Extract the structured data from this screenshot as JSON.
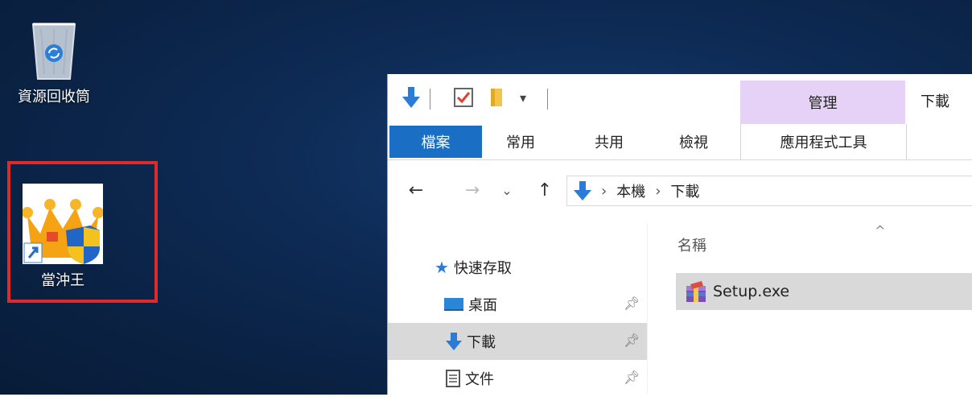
{
  "desktop": {
    "recycle_bin_label": "資源回收筒",
    "game_shortcut_label": "當沖王"
  },
  "explorer": {
    "ribbon": {
      "contextual_group": "管理",
      "window_title": "下載",
      "tabs": {
        "file": "檔案",
        "home": "常用",
        "share": "共用",
        "view": "檢視",
        "app_tools": "應用程式工具"
      }
    },
    "address": {
      "segments": [
        "本機",
        "下載"
      ]
    },
    "nav": {
      "quick_access": "快速存取",
      "desktop": "桌面",
      "downloads": "下載",
      "documents": "文件"
    },
    "files": {
      "column_name": "名稱",
      "items": [
        {
          "name": "Setup.exe"
        }
      ]
    }
  },
  "colors": {
    "desktop_bg": "#0e2c57",
    "file_tab": "#1a6fc4",
    "manage_tab": "#e6d2f6",
    "highlight_box": "#e0292a",
    "selection": "#d9d9d9"
  }
}
